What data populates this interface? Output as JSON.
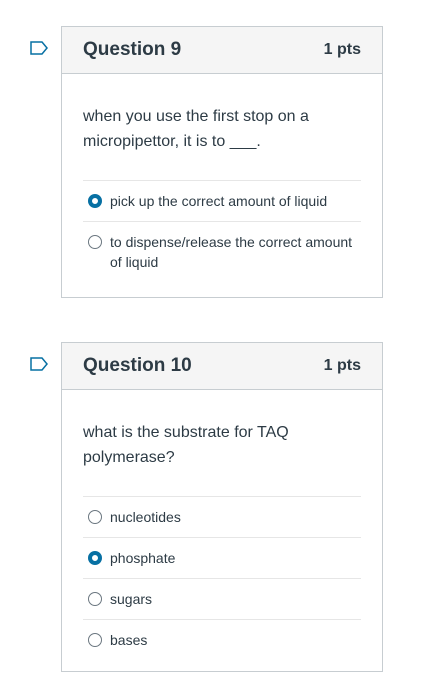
{
  "questions": [
    {
      "title": "Question 9",
      "points": "1 pts",
      "text": "when you use the first stop on a micropipettor, it is to ___.",
      "answers": [
        {
          "label": "pick up the correct amount of liquid",
          "selected": true
        },
        {
          "label": "to dispense/release the correct amount of liquid",
          "selected": false
        }
      ]
    },
    {
      "title": "Question 10",
      "points": "1 pts",
      "text": "what is the substrate for TAQ polymerase?",
      "answers": [
        {
          "label": "nucleotides",
          "selected": false
        },
        {
          "label": "phosphate",
          "selected": true
        },
        {
          "label": "sugars",
          "selected": false
        },
        {
          "label": "bases",
          "selected": false
        }
      ]
    }
  ],
  "colors": {
    "accent": "#0770a3",
    "header_bg": "#f5f5f5",
    "border": "#c7cdd1",
    "text": "#2d3b45"
  },
  "icons": {
    "flag": "flag-outline-icon",
    "radio_checked": "radio-checked-icon",
    "radio_unchecked": "radio-unchecked-icon"
  }
}
